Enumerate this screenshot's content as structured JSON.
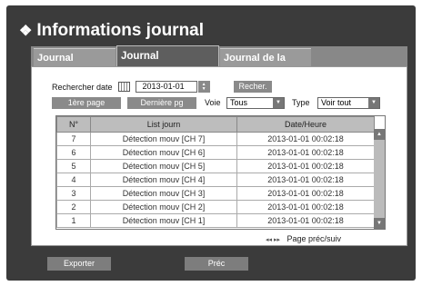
{
  "title": "Informations journal",
  "tabs": [
    {
      "label": "Journal système"
    },
    {
      "label": "Journal événements"
    },
    {
      "label": "Journal de la sauv."
    }
  ],
  "search": {
    "label": "Rechercher date",
    "date": "2013-01-01",
    "button": "Recher."
  },
  "nav": {
    "first_page": "1ère page",
    "last_page": "Dernière pg",
    "voie_label": "Voie",
    "voie_value": "Tous",
    "type_label": "Type",
    "type_value": "Voir tout"
  },
  "table": {
    "headers": [
      "N°",
      "List journ",
      "Date/Heure"
    ],
    "rows": [
      {
        "n": "7",
        "journ": "Détection mouv [CH 7]",
        "date": "2013-01-01 00:02:18"
      },
      {
        "n": "6",
        "journ": "Détection mouv [CH 6]",
        "date": "2013-01-01 00:02:18"
      },
      {
        "n": "5",
        "journ": "Détection mouv [CH 5]",
        "date": "2013-01-01 00:02:18"
      },
      {
        "n": "4",
        "journ": "Détection mouv [CH 4]",
        "date": "2013-01-01 00:02:18"
      },
      {
        "n": "3",
        "journ": "Détection mouv [CH 3]",
        "date": "2013-01-01 00:02:18"
      },
      {
        "n": "2",
        "journ": "Détection mouv [CH 2]",
        "date": "2013-01-01 00:02:18"
      },
      {
        "n": "1",
        "journ": "Détection mouv [CH 1]",
        "date": "2013-01-01 00:02:18"
      }
    ]
  },
  "pager": {
    "icon": "◂◂ ▸▸",
    "label": "Page préc/suiv"
  },
  "footer": {
    "export": "Exporter",
    "prev": "Préc"
  }
}
